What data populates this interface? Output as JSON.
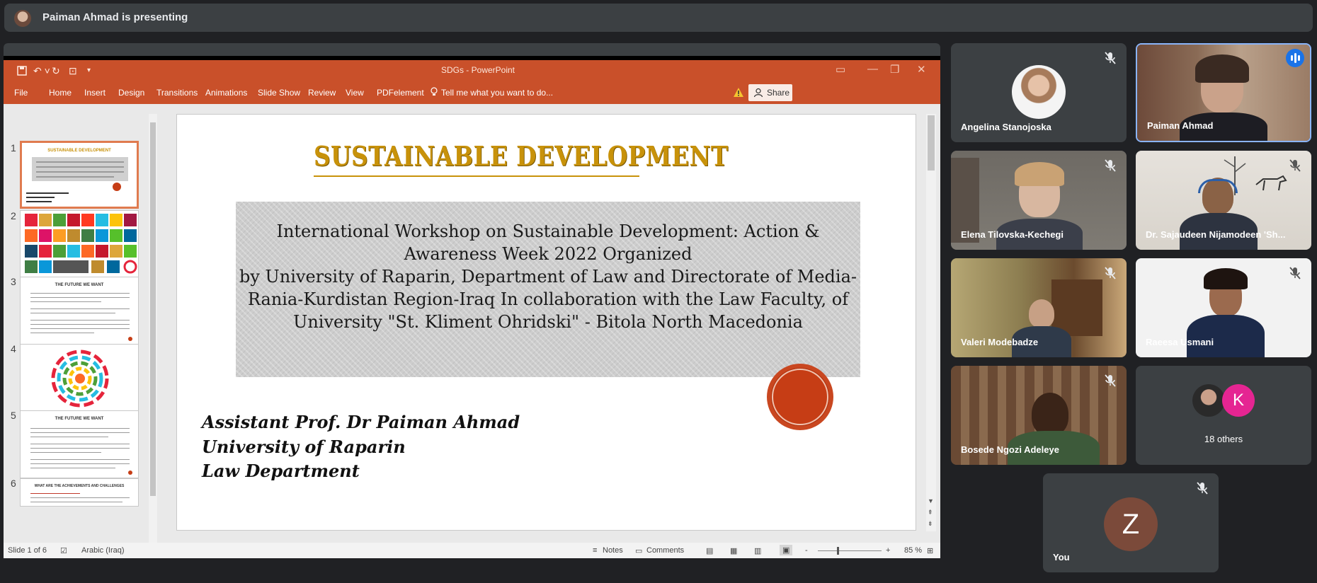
{
  "presenting": {
    "text": "Paiman Ahmad is presenting"
  },
  "ppt": {
    "doc_title": "SDGs - PowerPoint",
    "tabs": [
      "File",
      "Home",
      "Insert",
      "Design",
      "Transitions",
      "Animations",
      "Slide Show",
      "Review",
      "View",
      "PDFelement"
    ],
    "tell_me": "Tell me what you want to do...",
    "share": "Share",
    "thumbnail_numbers": [
      "1",
      "2",
      "3",
      "4",
      "5",
      "6"
    ],
    "thumbnail_headings": {
      "t1": "SUSTAINABLE DEVELOPMENT",
      "t3": "THE FUTURE WE WANT",
      "t5": "THE FUTURE WE WANT",
      "t6": "WHAT ARE THE ACHIEVEMENTS AND CHALLENGES"
    },
    "slide": {
      "title": "SUSTAINABLE DEVELOPMENT",
      "workshop_lines": [
        "International Workshop on Sustainable Development: Action &",
        "Awareness Week 2022 Organized",
        "by University of Raparin, Department of Law and Directorate of Media-",
        "Rania-Kurdistan Region-Iraq In collaboration with the Law Faculty, of",
        "University \"St. Kliment Ohridski\" - Bitola North Macedonia"
      ],
      "author_lines": [
        "Assistant Prof. Dr Paiman Ahmad",
        "University of Raparin",
        "Law Department"
      ]
    },
    "status": {
      "slide_info": "Slide 1 of 6",
      "language": "Arabic (Iraq)",
      "notes": "Notes",
      "comments": "Comments",
      "zoom_minus": "-",
      "zoom_plus": "+",
      "zoom": "85 %"
    }
  },
  "participants": {
    "p1": "Angelina Stanojoska",
    "p2": "Paiman Ahmad",
    "p3": "Elena Tilovska-Kechegi",
    "p4": "Dr. Sajaudeen Nijamodeen 'Sh...",
    "p5": "Valeri Modebadze",
    "p6": "Raeesa Usmani",
    "p7": "Bosede Ngozi Adeleye",
    "others": {
      "initial": "K",
      "label": "18 others"
    },
    "you": {
      "initial": "Z",
      "label": "You"
    }
  },
  "colors": {
    "ppt_orange": "#c9502a",
    "tile_bg": "#3c4043",
    "speaking_border": "#8ab4f8",
    "gold_title": "#c8920a"
  }
}
